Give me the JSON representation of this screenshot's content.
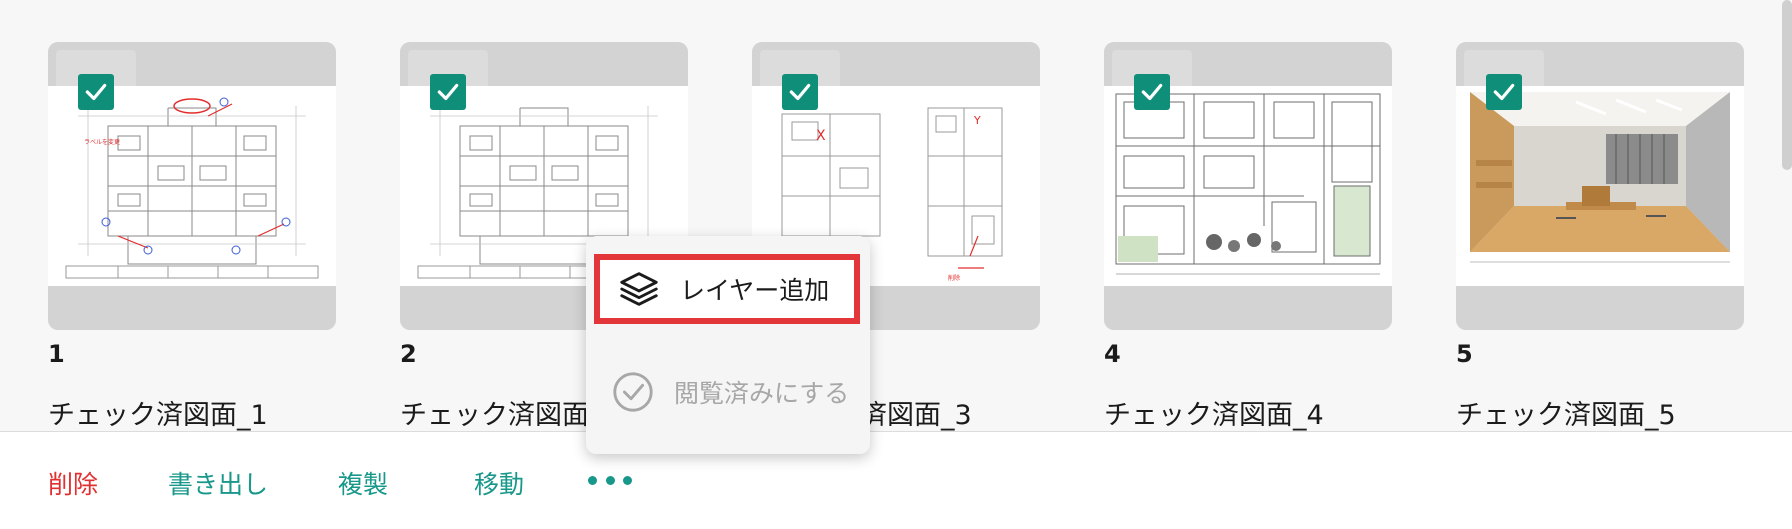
{
  "drawings": [
    {
      "number": "1",
      "name": "チェック済図面_1",
      "checked": true
    },
    {
      "number": "2",
      "name": "チェック済図面_2",
      "checked": true
    },
    {
      "number": "3",
      "name": "チェック済図面_3",
      "checked": true
    },
    {
      "number": "4",
      "name": "チェック済図面_4",
      "checked": true
    },
    {
      "number": "5",
      "name": "チェック済図面_5",
      "checked": true
    }
  ],
  "context_menu": {
    "add_layer": {
      "label": "レイヤー追加",
      "icon": "layers-icon"
    },
    "mark_viewed": {
      "label": "閲覧済みにする",
      "icon": "check-circle-icon"
    }
  },
  "toolbar": {
    "delete_label": "削除",
    "export_label": "書き出し",
    "duplicate_label": "複製",
    "move_label": "移動",
    "more_icon": "more-horizontal-icon"
  },
  "colors": {
    "accent": "#17988a",
    "checkbox": "#0f8f79",
    "delete": "#e03030",
    "highlight_border": "#e2363a",
    "muted_text": "#a7a7a7"
  }
}
